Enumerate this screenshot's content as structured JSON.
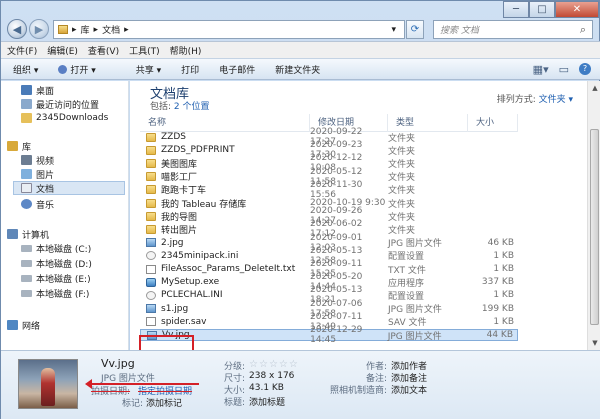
{
  "address": {
    "crumbs": [
      "库",
      "文档"
    ],
    "search_placeholder": "搜索 文档"
  },
  "window_controls": {
    "minimize": "─",
    "maximize": "□",
    "close": "✕"
  },
  "menu": [
    "文件(F)",
    "编辑(E)",
    "查看(V)",
    "工具(T)",
    "帮助(H)"
  ],
  "toolbar": [
    "组织 ▾",
    "打开 ▾",
    "共享 ▾",
    "打印",
    "电子邮件",
    "新建文件夹"
  ],
  "nav": [
    {
      "label": "桌面",
      "icon": "desktop-icon"
    },
    {
      "label": "最近访问的位置",
      "icon": "recent-places-icon"
    },
    {
      "label": "2345Downloads",
      "icon": "folder-icon"
    },
    {
      "label": "库",
      "icon": "library-icon"
    },
    {
      "label": "视频",
      "icon": "video-icon"
    },
    {
      "label": "图片",
      "icon": "picture-icon"
    },
    {
      "label": "文档",
      "icon": "document-icon",
      "selected": true
    },
    {
      "label": "音乐",
      "icon": "music-icon"
    },
    {
      "label": "计算机",
      "icon": "computer-icon"
    },
    {
      "label": "本地磁盘 (C:)",
      "icon": "drive-icon"
    },
    {
      "label": "本地磁盘 (D:)",
      "icon": "drive-icon"
    },
    {
      "label": "本地磁盘 (E:)",
      "icon": "drive-icon"
    },
    {
      "label": "本地磁盘 (F:)",
      "icon": "drive-icon"
    },
    {
      "label": "网络",
      "icon": "network-icon"
    }
  ],
  "library": {
    "title": "文档库",
    "includes_label": "包括:",
    "includes_value": "2 个位置",
    "arrange_label": "排列方式:",
    "arrange_value": "文件夹 ▾"
  },
  "columns": [
    "名称",
    "修改日期",
    "类型",
    "大小"
  ],
  "files": [
    {
      "name": "ZZDS",
      "date": "2020-09-22 17:27",
      "type": "文件夹",
      "size": "",
      "kind": "folder"
    },
    {
      "name": "ZZDS_PDFPRINT",
      "date": "2020-09-23 17:30",
      "type": "文件夹",
      "size": "",
      "kind": "folder"
    },
    {
      "name": "美图图库",
      "date": "2020-12-12 10:08",
      "type": "文件夹",
      "size": "",
      "kind": "folder"
    },
    {
      "name": "喵影工厂",
      "date": "2020-05-12 11:58",
      "type": "文件夹",
      "size": "",
      "kind": "folder"
    },
    {
      "name": "跑跑卡丁车",
      "date": "2020-11-30 15:56",
      "type": "文件夹",
      "size": "",
      "kind": "folder"
    },
    {
      "name": "我的 Tableau 存储库",
      "date": "2020-10-19 9:30",
      "type": "文件夹",
      "size": "",
      "kind": "folder"
    },
    {
      "name": "我的导图",
      "date": "2020-09-26 14:27",
      "type": "文件夹",
      "size": "",
      "kind": "folder"
    },
    {
      "name": "转出图片",
      "date": "2020-06-02 17:12",
      "type": "文件夹",
      "size": "",
      "kind": "folder"
    },
    {
      "name": "2.jpg",
      "date": "2020-09-01 12:03",
      "type": "JPG 图片文件",
      "size": "46 KB",
      "kind": "image"
    },
    {
      "name": "2345minipack.ini",
      "date": "2020-05-13 12:58",
      "type": "配置设置",
      "size": "1 KB",
      "kind": "gear"
    },
    {
      "name": "FileAssoc_Params_DeleteIt.txt",
      "date": "2020-09-11 15:25",
      "type": "TXT 文件",
      "size": "1 KB",
      "kind": "text"
    },
    {
      "name": "MySetup.exe",
      "date": "2020-05-20 14:44",
      "type": "应用程序",
      "size": "337 KB",
      "kind": "exe"
    },
    {
      "name": "PCLECHAL.INI",
      "date": "2020-05-13 18:21",
      "type": "配置设置",
      "size": "1 KB",
      "kind": "gear"
    },
    {
      "name": "s1.jpg",
      "date": "2020-07-06 17:58",
      "type": "JPG 图片文件",
      "size": "199 KB",
      "kind": "image"
    },
    {
      "name": "spider.sav",
      "date": "2020-07-11 13:49",
      "type": "SAV 文件",
      "size": "1 KB",
      "kind": "text"
    },
    {
      "name": "Vv.jpg",
      "date": "2020-12-29 14:45",
      "type": "JPG 图片文件",
      "size": "44 KB",
      "kind": "image",
      "selected": true
    }
  ],
  "details": {
    "filename": "Vv.jpg",
    "filetype": "JPG 图片文件",
    "date_label": "拍摄日期:",
    "date_value": "指定拍摄日期",
    "tags_label": "标记:",
    "tags_value": "添加标记",
    "rating_label": "分级:",
    "rating": 0,
    "dimensions_label": "尺寸:",
    "dimensions_value": "238 x 176",
    "size_label": "大小:",
    "size_value": "43.1 KB",
    "title_label": "标题:",
    "title_value": "添加标题",
    "author_label": "作者:",
    "author_value": "添加作者",
    "comments_label": "备注:",
    "comments_value": "添加备注",
    "camera_label": "照相机制造商:",
    "camera_value": "添加文本"
  },
  "colors": {
    "highlight": "#d42027",
    "selection": "#cfe3f8",
    "link": "#1f5fb0"
  }
}
